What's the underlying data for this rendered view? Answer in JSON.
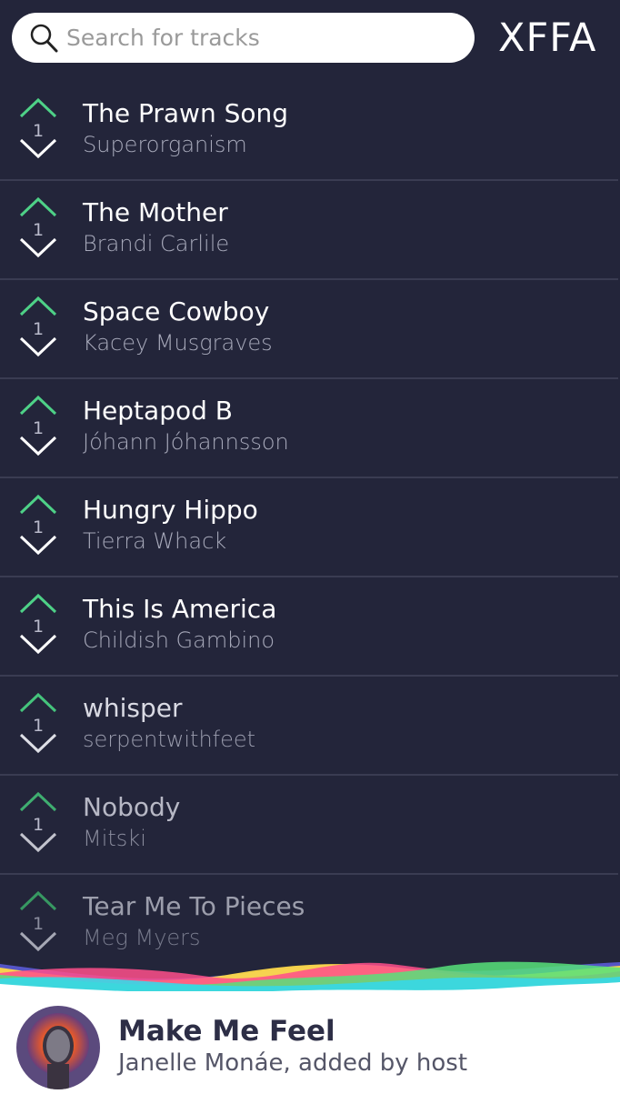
{
  "search": {
    "placeholder": "Search for tracks",
    "value": ""
  },
  "brand": "XFFA",
  "colors": {
    "background": "#23253a",
    "upvote": "#4ed187",
    "downvote": "#ffffff",
    "divider": "#3a3c52"
  },
  "queue": [
    {
      "title": "The Prawn Song",
      "artist": "Superorganism",
      "votes": "1"
    },
    {
      "title": "The Mother",
      "artist": "Brandi Carlile",
      "votes": "1"
    },
    {
      "title": "Space Cowboy",
      "artist": "Kacey Musgraves",
      "votes": "1"
    },
    {
      "title": "Heptapod B",
      "artist": "Jóhann Jóhannsson",
      "votes": "1"
    },
    {
      "title": "Hungry Hippo",
      "artist": "Tierra Whack",
      "votes": "1"
    },
    {
      "title": "This Is America",
      "artist": "Childish Gambino",
      "votes": "1"
    },
    {
      "title": "whisper",
      "artist": "serpentwithfeet",
      "votes": "1"
    },
    {
      "title": "Nobody",
      "artist": "Mitski",
      "votes": "1"
    },
    {
      "title": "Tear Me To Pieces",
      "artist": "Meg Myers",
      "votes": "1"
    }
  ],
  "now_playing": {
    "title": "Make Me Feel",
    "subtitle": "Janelle Monáe, added by host"
  }
}
